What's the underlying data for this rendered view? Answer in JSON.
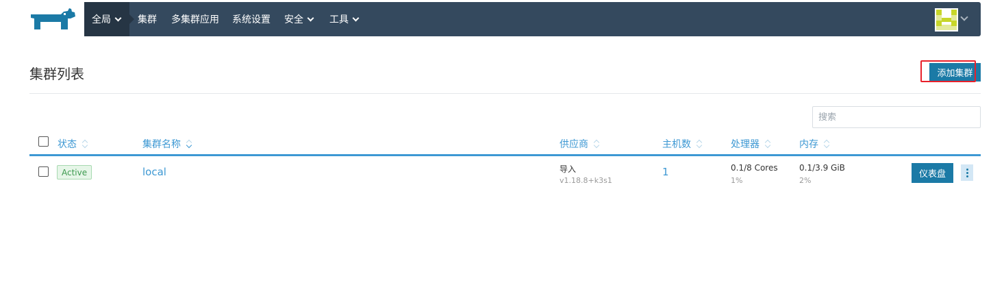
{
  "nav": {
    "items": [
      {
        "label": "全局",
        "dropdown": true,
        "active": true
      },
      {
        "label": "集群",
        "dropdown": false
      },
      {
        "label": "多集群应用",
        "dropdown": false
      },
      {
        "label": "系统设置",
        "dropdown": false
      },
      {
        "label": "安全",
        "dropdown": true
      },
      {
        "label": "工具",
        "dropdown": true
      }
    ]
  },
  "page": {
    "title": "集群列表",
    "add_button": "添加集群",
    "search_placeholder": "搜索"
  },
  "table": {
    "headers": {
      "state": "状态",
      "name": "集群名称",
      "provider": "供应商",
      "nodes": "主机数",
      "cpu": "处理器",
      "memory": "内存"
    },
    "rows": [
      {
        "state": "Active",
        "name": "local",
        "provider": "导入",
        "provider_version": "v1.18.8+k3s1",
        "nodes": "1",
        "cpu": "0.1/8 Cores",
        "cpu_pct": "1%",
        "memory": "0.1/3.9 GiB",
        "memory_pct": "2%",
        "dashboard_button": "仪表盘"
      }
    ]
  },
  "colors": {
    "nav_bg": "#34495e",
    "primary": "#1b7aa6",
    "link": "#3d98d3",
    "active_badge": "#3d9a4f",
    "highlight": "#e8202a"
  }
}
